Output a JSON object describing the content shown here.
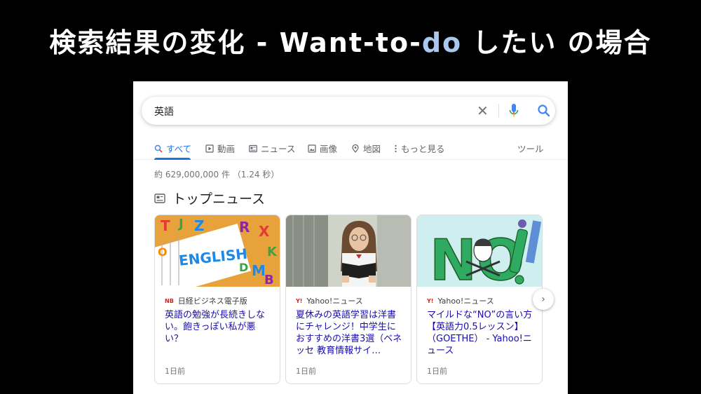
{
  "slide": {
    "title_pre": "検索結果の変化 - Want-to-",
    "title_hl": "do",
    "title_post": " したい の場合"
  },
  "search": {
    "query": "英語"
  },
  "tabs": [
    {
      "label": "すべて",
      "icon": "search-icon",
      "active": true
    },
    {
      "label": "動画",
      "icon": "video-icon"
    },
    {
      "label": "ニュース",
      "icon": "news-icon"
    },
    {
      "label": "画像",
      "icon": "image-icon"
    },
    {
      "label": "地図",
      "icon": "map-pin-icon"
    },
    {
      "label": "もっと見る",
      "icon": "more-vert-icon"
    },
    {
      "label": "ツール"
    }
  ],
  "result_stats": "約 629,000,000 件 （1.24 秒）",
  "top_news": {
    "title": "トップニュース",
    "cards": [
      {
        "source": "日経ビジネス電子版",
        "source_logo": "NB",
        "headline": "英語の勉強が長続きしない。飽きっぽい私が悪い？",
        "age": "1日前"
      },
      {
        "source": "Yahoo!ニュース",
        "source_logo": "Y!",
        "headline": "夏休みの英語学習は洋書にチャレンジ！中学生におすすめの洋書3選（ベネッセ 教育情報サイ…",
        "age": "1日前"
      },
      {
        "source": "Yahoo!ニュース",
        "source_logo": "Y!",
        "headline": "マイルドな“NO”の言い方【英語力0.5レッスン】（GOETHE） - Yahoo!ニュース",
        "age": "1日前"
      }
    ]
  },
  "colors": {
    "accent": "#1a73e8",
    "link": "#1a0dab",
    "title_highlight": "#a9c8f0"
  }
}
